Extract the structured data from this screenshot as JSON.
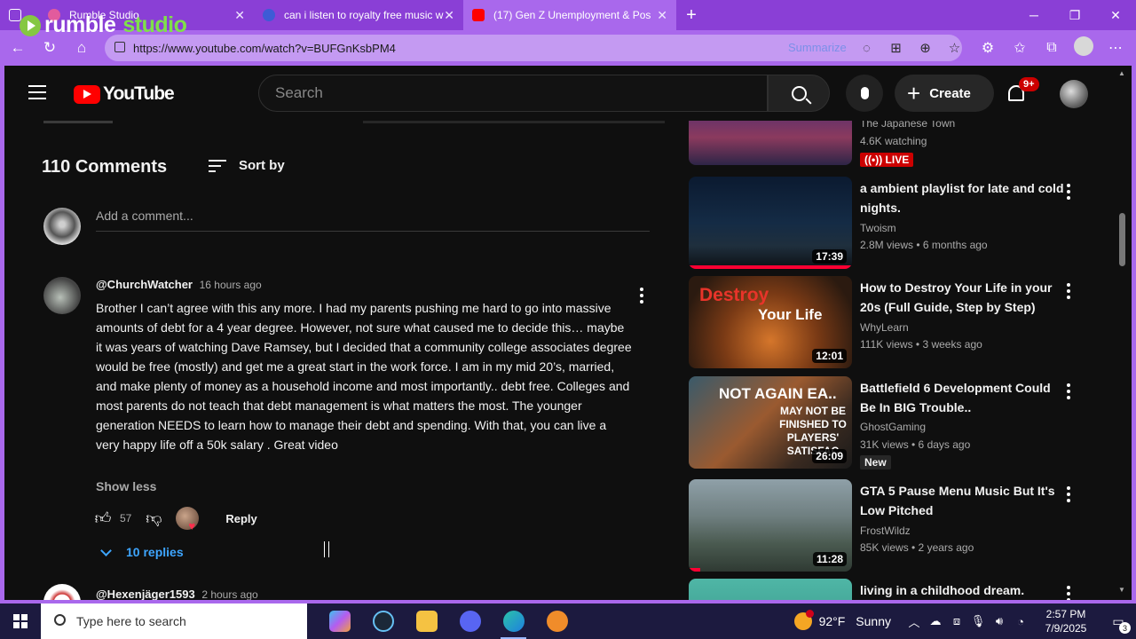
{
  "browser": {
    "tabs": [
      {
        "title": "Rumble Studio",
        "favicon_color": "#e25b9d"
      },
      {
        "title": "can i listen to royalty free music w",
        "favicon_color": "#3e5bd6"
      },
      {
        "title": "(17) Gen Z Unemployment & Pos",
        "favicon_color": "#ff0000"
      }
    ],
    "overlay_logo": {
      "part1": "rumble",
      "part2": "studio"
    },
    "url": "https://www.youtube.com/watch?v=BUFGnKsbPM4",
    "summarize_label": "Summarize",
    "window_controls": [
      "─",
      "❐",
      "✕"
    ]
  },
  "youtube": {
    "logo_text": "YouTube",
    "search_placeholder": "Search",
    "create_label": "Create",
    "notification_badge": "9+"
  },
  "comments": {
    "count_label": "110 Comments",
    "sort_label": "Sort by",
    "add_placeholder": "Add a comment...",
    "items": [
      {
        "author": "@ChurchWatcher",
        "time": "16 hours ago",
        "text": "Brother I can’t agree with this any more. I had my parents pushing me hard to go into massive amounts of debt for a 4 year degree. However, not sure what caused me to decide this… maybe it was years of watching Dave Ramsey, but I decided that a community college associates degree would be free (mostly) and get me a great start in the work force. I am in my mid 20’s, married, and make plenty of money as a household income and most importantly.. debt free. Colleges and most parents do not teach that debt management is what matters the most. The younger generation NEEDS to learn how to manage their debt and spending. With that, you can live a very happy life off a 50k salary . Great video",
        "show_less": "Show less",
        "likes": "57",
        "reply_label": "Reply",
        "replies_label": "10 replies"
      },
      {
        "author": "@Hexenjäger1593",
        "time": "2 hours ago"
      }
    ]
  },
  "sidebar": {
    "items": [
      {
        "title": "",
        "channel": "The Japanese Town",
        "meta": "4.6K watching",
        "badge": "LIVE",
        "duration": ""
      },
      {
        "title": "a ambient playlist for late and cold nights.",
        "channel": "Twoism",
        "meta": "2.8M views  •  6 months ago",
        "duration": "17:39",
        "progress": 1.0
      },
      {
        "title": "How to Destroy Your Life in your 20s (Full Guide, Step by Step)",
        "channel": "WhyLearn",
        "meta": "111K views  •  3 weeks ago",
        "duration": "12:01",
        "thumb_text1": "Destroy",
        "thumb_text2": "Your Life"
      },
      {
        "title": "Battlefield 6 Development Could Be In BIG Trouble..",
        "channel": "GhostGaming",
        "meta": "31K views  •  6 days ago",
        "duration": "26:09",
        "badge": "New",
        "thumb_text1": "NOT AGAIN EA..",
        "thumb_text2": "MAY NOT BE FINISHED TO PLAYERS' SATISFAC"
      },
      {
        "title": "GTA 5 Pause Menu Music But It's Low Pitched",
        "channel": "FrostWildz",
        "meta": "85K views  •  2 years ago",
        "duration": "11:28",
        "progress": 0.07
      },
      {
        "title": "living in a childhood dream.",
        "channel": "",
        "meta": "",
        "duration": ""
      }
    ]
  },
  "taskbar": {
    "search_placeholder": "Type here to search",
    "weather_temp": "92°F",
    "weather_cond": "Sunny",
    "time": "2:57 PM",
    "date": "7/9/2025",
    "notification_count": "3"
  }
}
